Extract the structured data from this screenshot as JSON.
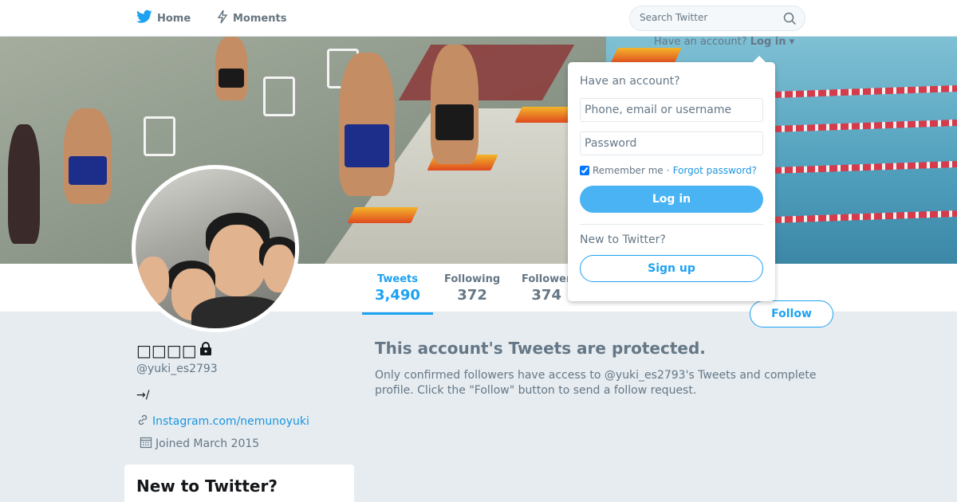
{
  "nav": {
    "home_label": "Home",
    "moments_label": "Moments",
    "search_placeholder": "Search Twitter"
  },
  "profile": {
    "name": "□□□□",
    "handle": "@yuki_es2793",
    "bio": "→/",
    "url_text": "Instagram.com/nemunoyuki",
    "joined": "Joined March 2015"
  },
  "stats": [
    {
      "label": "Tweets",
      "value": "3,490",
      "active": true
    },
    {
      "label": "Following",
      "value": "372",
      "active": false
    },
    {
      "label": "Follower",
      "value": "374",
      "active": false
    }
  ],
  "follow_button": "Follow",
  "protected": {
    "title": "This account's Tweets are protected.",
    "body": "Only confirmed followers have access to @yuki_es2793's Tweets and complete profile. Click the \"Follow\" button to send a follow request."
  },
  "sidebar_card": {
    "title": "New to Twitter?"
  },
  "login": {
    "toggle_prefix": "Have an account?",
    "toggle_label": "Log in",
    "heading": "Have an account?",
    "username_placeholder": "Phone, email or username",
    "password_placeholder": "Password",
    "remember_label": "Remember me",
    "separator": "·",
    "forgot_label": "Forgot password?",
    "login_button": "Log in",
    "new_heading": "New to Twitter?",
    "signup_button": "Sign up"
  },
  "colors": {
    "accent": "#1da1f2",
    "login_button_bg": "#4ab3f4",
    "page_bg": "#e6ecf0"
  },
  "icons": [
    "twitter-bird-icon",
    "lightning-icon",
    "search-icon",
    "lock-icon",
    "link-icon",
    "calendar-icon",
    "chevron-down-icon"
  ]
}
